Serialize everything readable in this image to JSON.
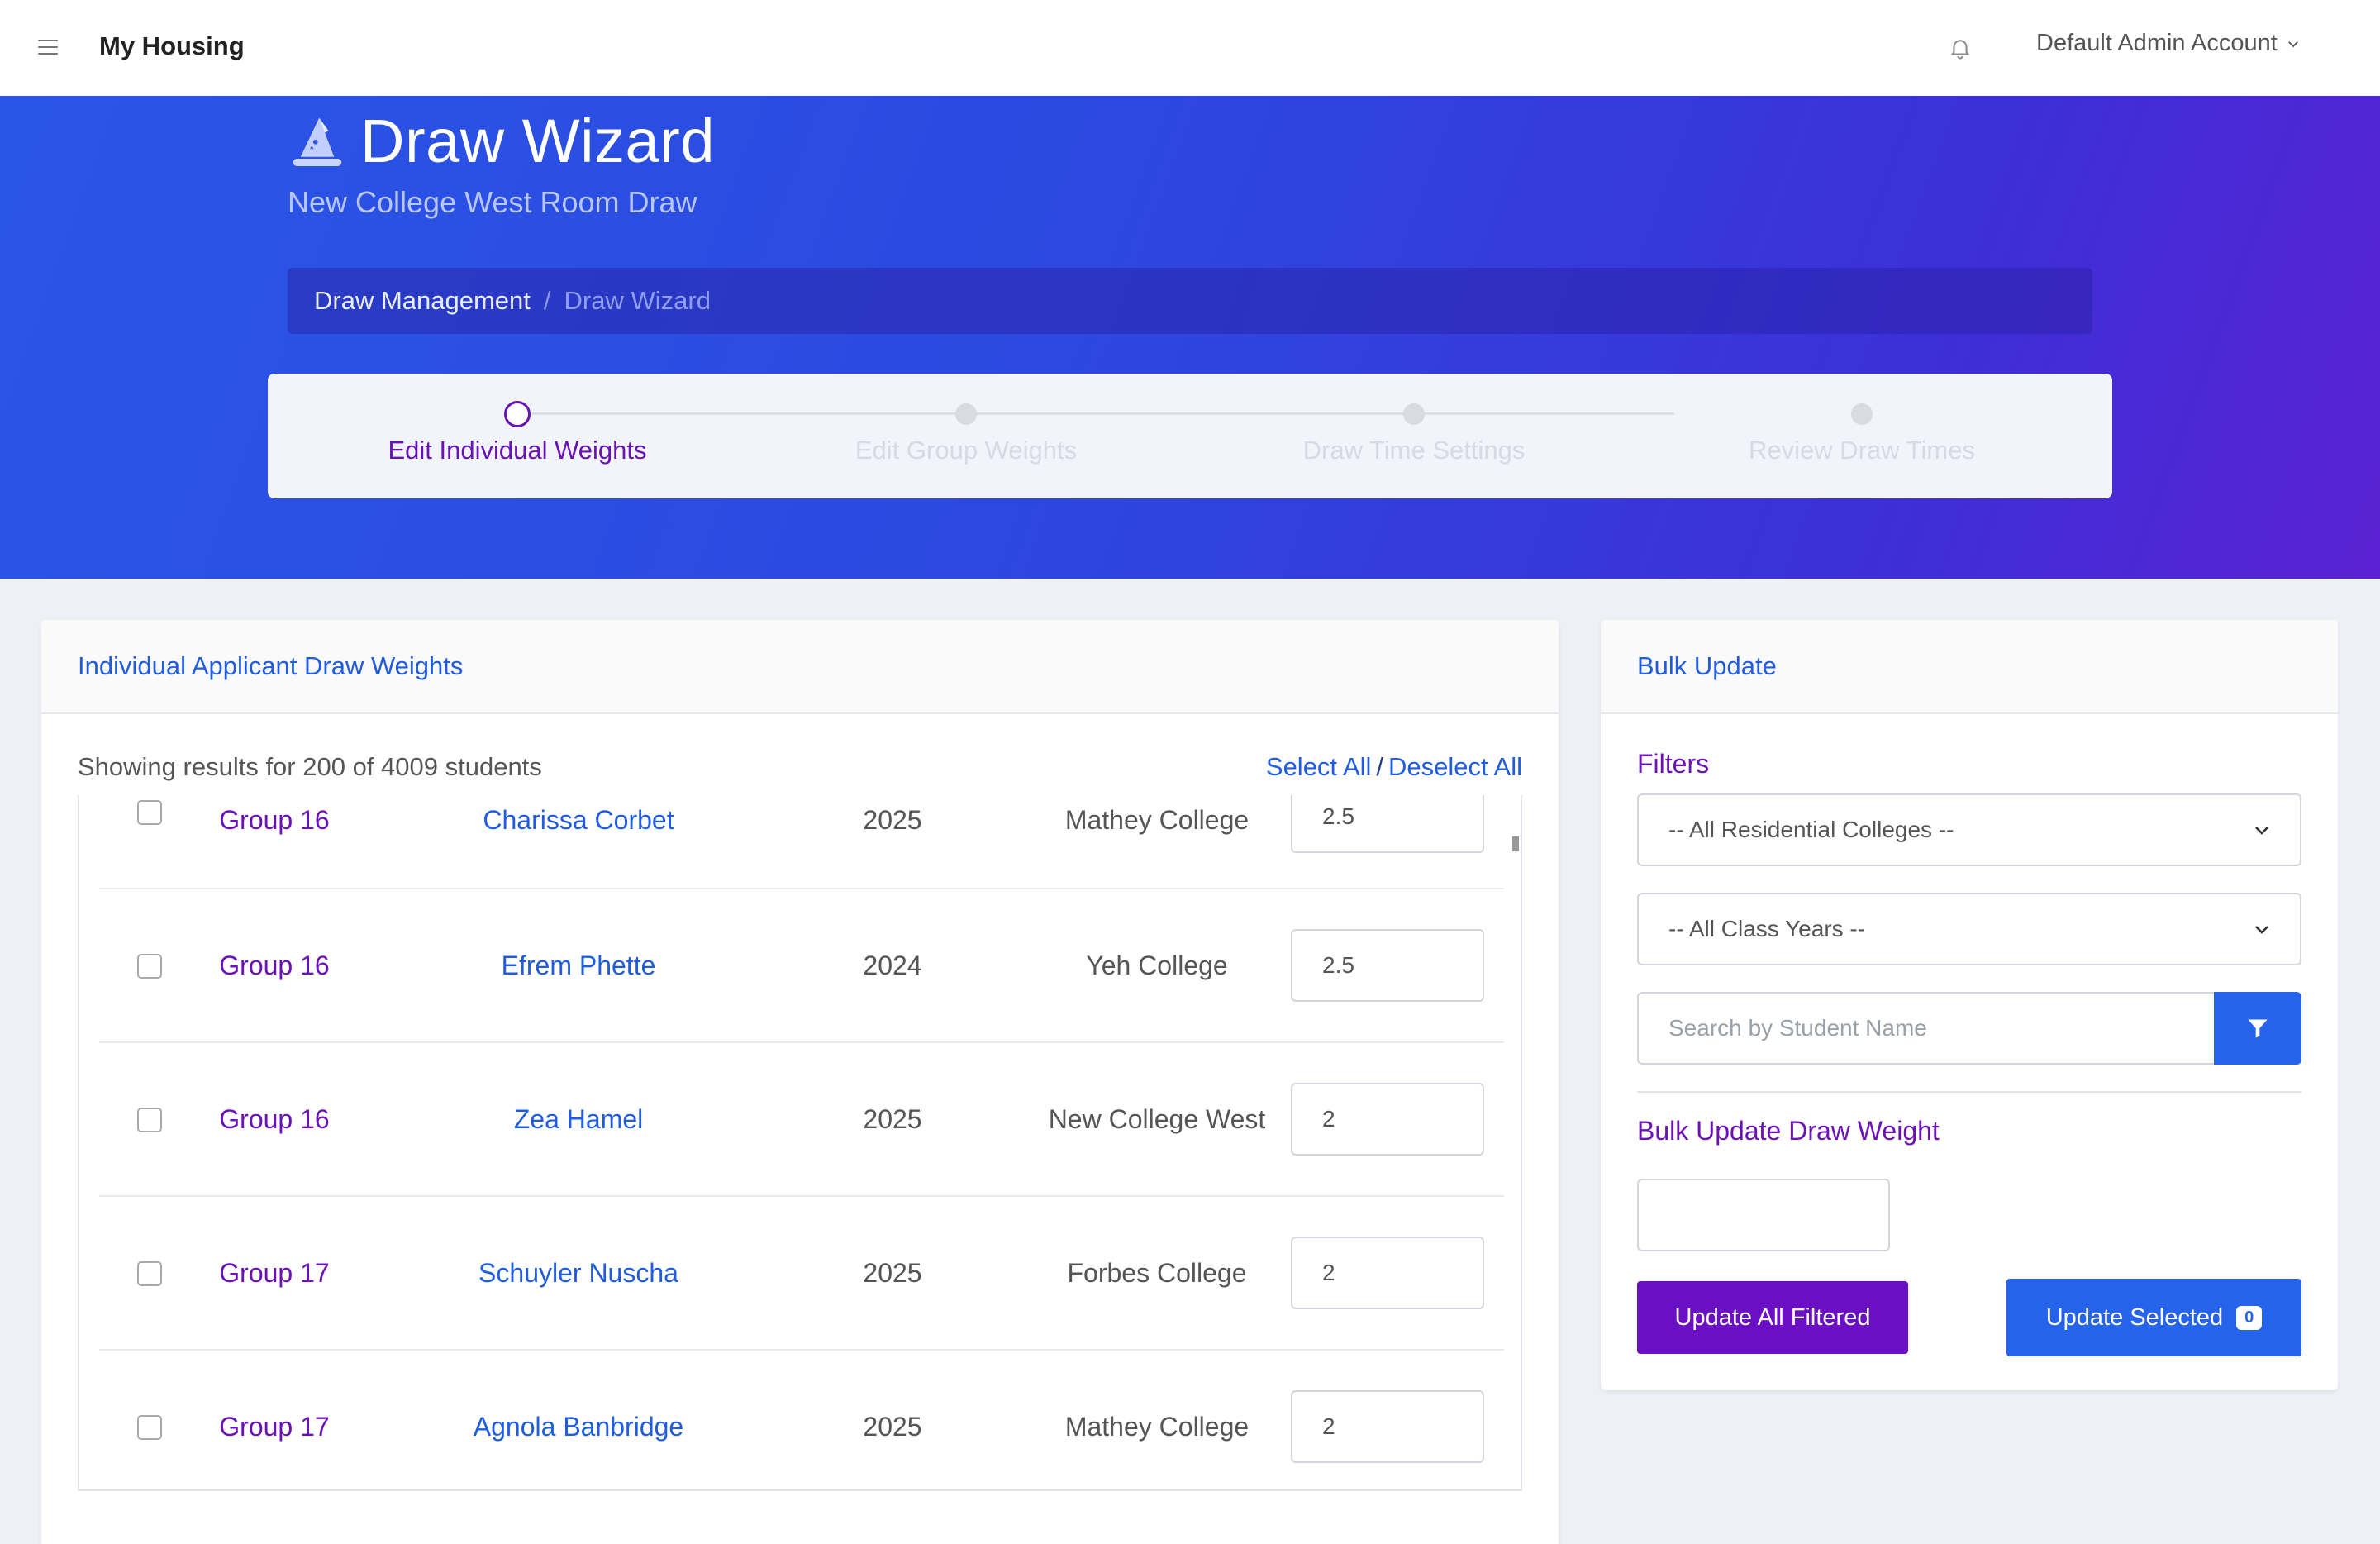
{
  "topbar": {
    "app_title": "My Housing",
    "account_name": "Default Admin Account",
    "menu_icon": "hamburger-icon",
    "notification_icon": "bell-icon"
  },
  "hero": {
    "icon": "wizard-hat-icon",
    "title": "Draw Wizard",
    "subtitle": "New College West Room Draw",
    "breadcrumb": [
      "Draw Management",
      "Draw Wizard"
    ],
    "breadcrumb_separator": "/"
  },
  "stepper": {
    "active_index": 0,
    "steps": [
      {
        "label": "Edit Individual Weights"
      },
      {
        "label": "Edit Group Weights"
      },
      {
        "label": "Draw Time Settings"
      },
      {
        "label": "Review Draw Times"
      }
    ]
  },
  "weights_card": {
    "title": "Individual Applicant Draw Weights",
    "showing_text": "Showing results for 200 of 4009 students",
    "select_all": "Select All",
    "deselect_all": "Deselect All",
    "rows": [
      {
        "group": "Group 16",
        "name": "Charissa Corbet",
        "year": "2025",
        "college": "Mathey College",
        "weight": "2.5",
        "checked": false
      },
      {
        "group": "Group 16",
        "name": "Efrem Phette",
        "year": "2024",
        "college": "Yeh College",
        "weight": "2.5",
        "checked": false
      },
      {
        "group": "Group 16",
        "name": "Zea Hamel",
        "year": "2025",
        "college": "New College West",
        "weight": "2",
        "checked": false
      },
      {
        "group": "Group 17",
        "name": "Schuyler Nuscha",
        "year": "2025",
        "college": "Forbes College",
        "weight": "2",
        "checked": false
      },
      {
        "group": "Group 17",
        "name": "Agnola Banbridge",
        "year": "2025",
        "college": "Mathey College",
        "weight": "2",
        "checked": false
      }
    ]
  },
  "bulk_card": {
    "title": "Bulk Update",
    "filters_label": "Filters",
    "college_select": "-- All Residential Colleges --",
    "year_select": "-- All Class Years --",
    "search_placeholder": "Search by Student Name",
    "search_value": "",
    "bulk_label": "Bulk Update Draw Weight",
    "bulk_value": "",
    "update_all_label": "Update All Filtered",
    "update_selected_label": "Update Selected",
    "selected_count": "0",
    "colors": {
      "primary_blue": "#2563eb",
      "accent_purple": "#6a0fc4"
    }
  }
}
